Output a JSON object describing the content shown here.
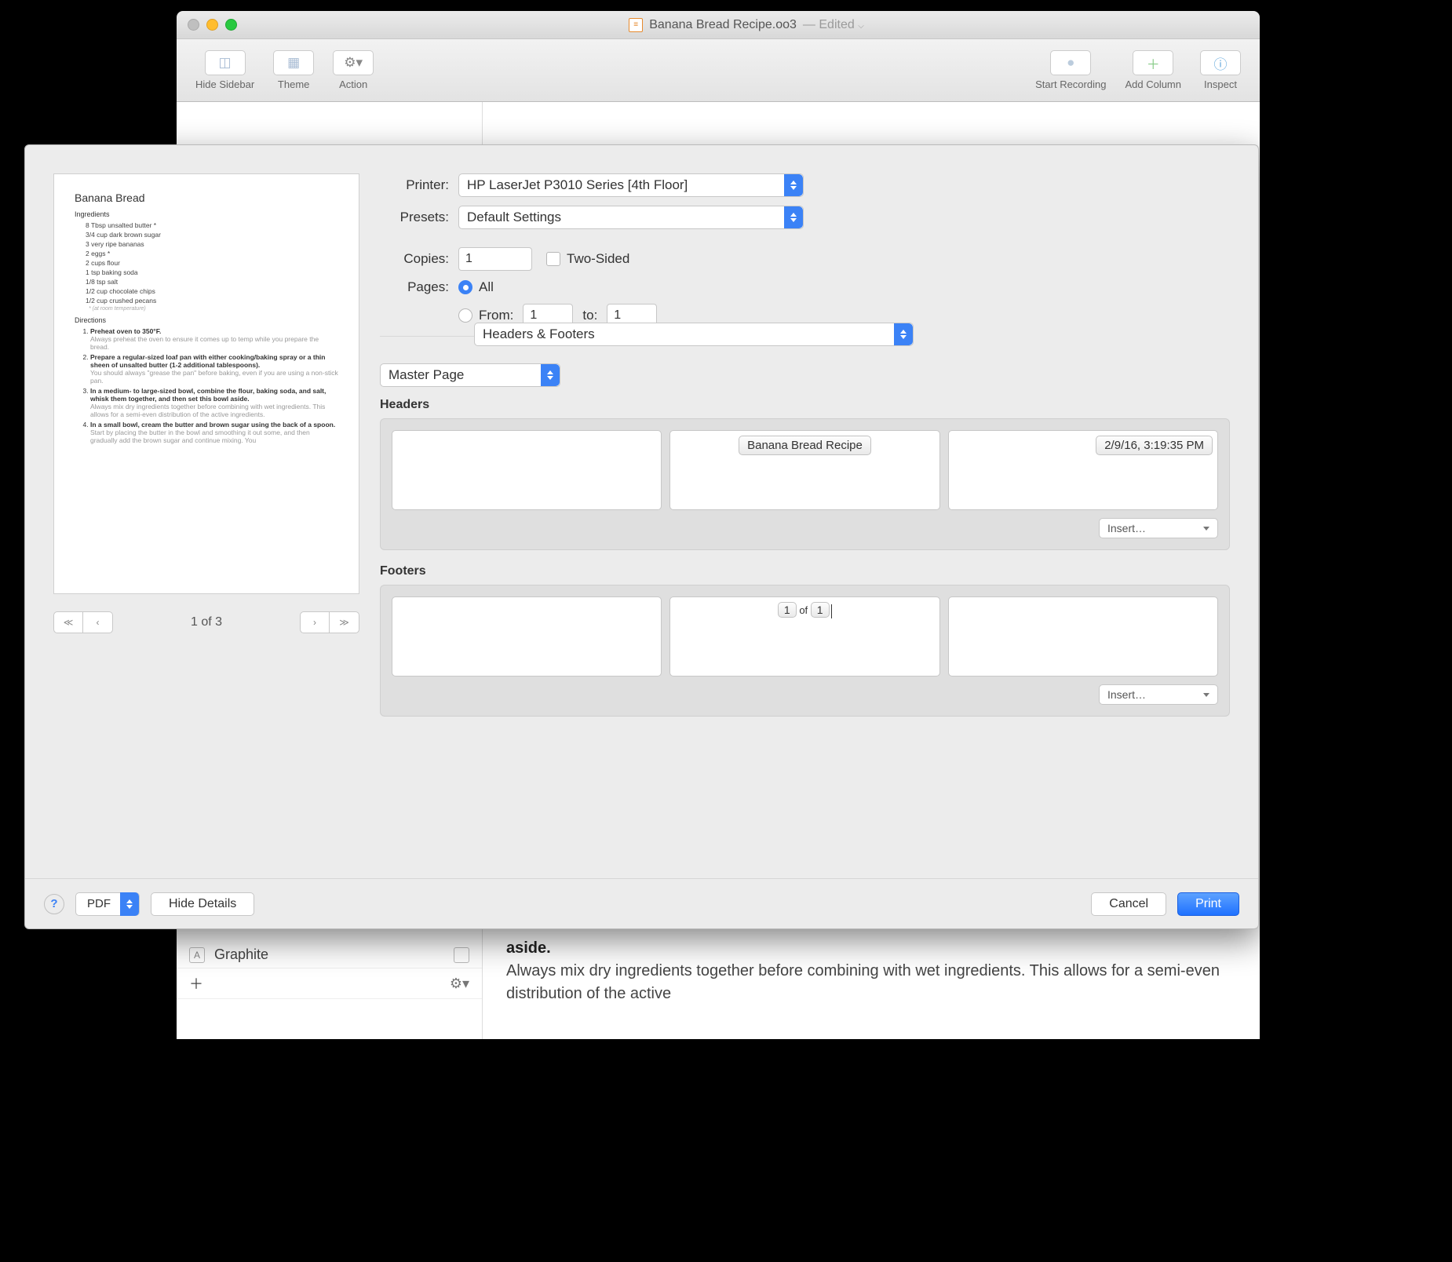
{
  "window": {
    "title": "Banana Bread Recipe.oo3",
    "edited": "— Edited"
  },
  "toolbar": {
    "hide_sidebar": "Hide Sidebar",
    "theme": "Theme",
    "action": "Action",
    "start_recording": "Start Recording",
    "add_column": "Add Column",
    "inspect": "Inspect"
  },
  "print": {
    "printer_label": "Printer:",
    "printer_value": "HP LaserJet P3010 Series [4th Floor]",
    "presets_label": "Presets:",
    "presets_value": "Default Settings",
    "copies_label": "Copies:",
    "copies_value": "1",
    "two_sided": "Two-Sided",
    "pages_label": "Pages:",
    "pages_all": "All",
    "pages_from": "From:",
    "pages_from_val": "1",
    "pages_to_label": "to:",
    "pages_to_val": "1",
    "section_value": "Headers & Footers",
    "master_page": "Master Page",
    "headers_label": "Headers",
    "header_center": "Banana Bread Recipe",
    "header_right": "2/9/16, 3:19:35 PM",
    "footers_label": "Footers",
    "footer_center_a": "1",
    "footer_center_of": " of ",
    "footer_center_b": "1",
    "insert": "Insert…",
    "pdf": "PDF",
    "hide_details": "Hide Details",
    "cancel": "Cancel",
    "print_btn": "Print",
    "pager": "1 of 3"
  },
  "preview": {
    "title": "Banana Bread",
    "ingredients_label": "Ingredients",
    "ing": [
      "8 Tbsp unsalted butter *",
      "3/4 cup dark brown sugar",
      "3 very ripe bananas",
      "2 eggs *",
      "2 cups flour",
      "1 tsp baking soda",
      "1/8 tsp salt",
      "1/2 cup chocolate chips",
      "1/2 cup crushed pecans"
    ],
    "note": "* (at room temperature)",
    "directions_label": "Directions",
    "dir1_b": "Preheat oven to 350°F.",
    "dir1_l": "Always preheat the oven to ensure it comes up to temp while you prepare the bread.",
    "dir2_b": "Prepare a regular-sized loaf pan with either cooking/baking spray or a thin sheen of unsalted butter (1-2 additional tablespoons).",
    "dir2_l": "You should always \"grease the pan\" before baking, even if you are using a non-stick pan.",
    "dir3_b": "In a medium- to large-sized bowl, combine the flour, baking soda, and salt, whisk them together, and then set this bowl aside.",
    "dir3_l": "Always mix dry ingredients together before combining with wet ingredients. This allows for a semi-even distribution of the active ingredients.",
    "dir4_b": "In a small bowl, cream the butter and brown sugar using the back of a spoon.",
    "dir4_l": "Start by placing the butter in the bowl and smoothing it out some, and then gradually add the brown sugar and continue mixing. You"
  },
  "underlay": {
    "graphite": "Graphite",
    "aside": "aside.",
    "body": "Always mix dry ingredients together before combining with wet ingredients. This allows for a semi-even distribution of the active"
  }
}
